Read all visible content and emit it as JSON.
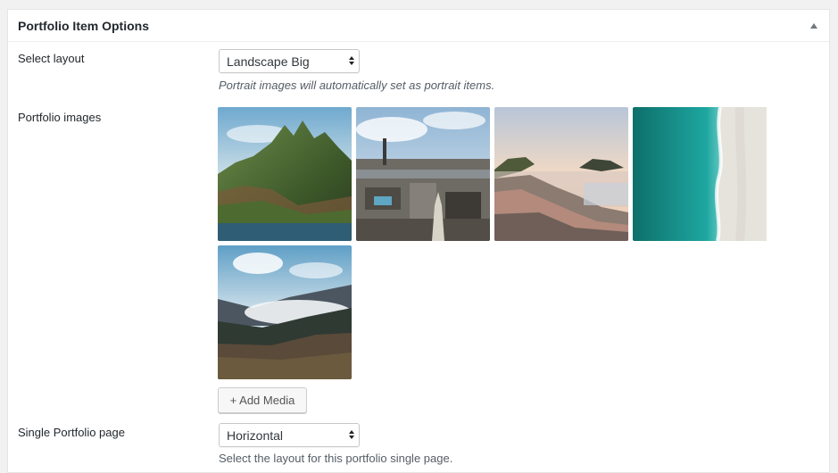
{
  "metabox": {
    "title": "Portfolio Item Options",
    "toggle_icon": "arrow-up-icon"
  },
  "layout": {
    "label": "Select layout",
    "selected": "Landscape Big",
    "description": "Portrait images will automatically set as portrait items."
  },
  "images": {
    "label": "Portfolio images",
    "items": [
      {
        "subject": "green mountain cliffs by the sea"
      },
      {
        "subject": "aerial city view with tower"
      },
      {
        "subject": "coastal town at sunset"
      },
      {
        "subject": "turquoise sea and sandy beach"
      },
      {
        "subject": "misty mountain valley"
      }
    ],
    "add_button": "+ Add Media"
  },
  "single_page": {
    "label": "Single Portfolio page",
    "selected": "Horizontal",
    "description": "Select the layout for this portfolio single page."
  },
  "colors": {
    "background": "#f1f1f1",
    "panel": "#ffffff",
    "text": "#23282d",
    "description": "#555d66"
  }
}
